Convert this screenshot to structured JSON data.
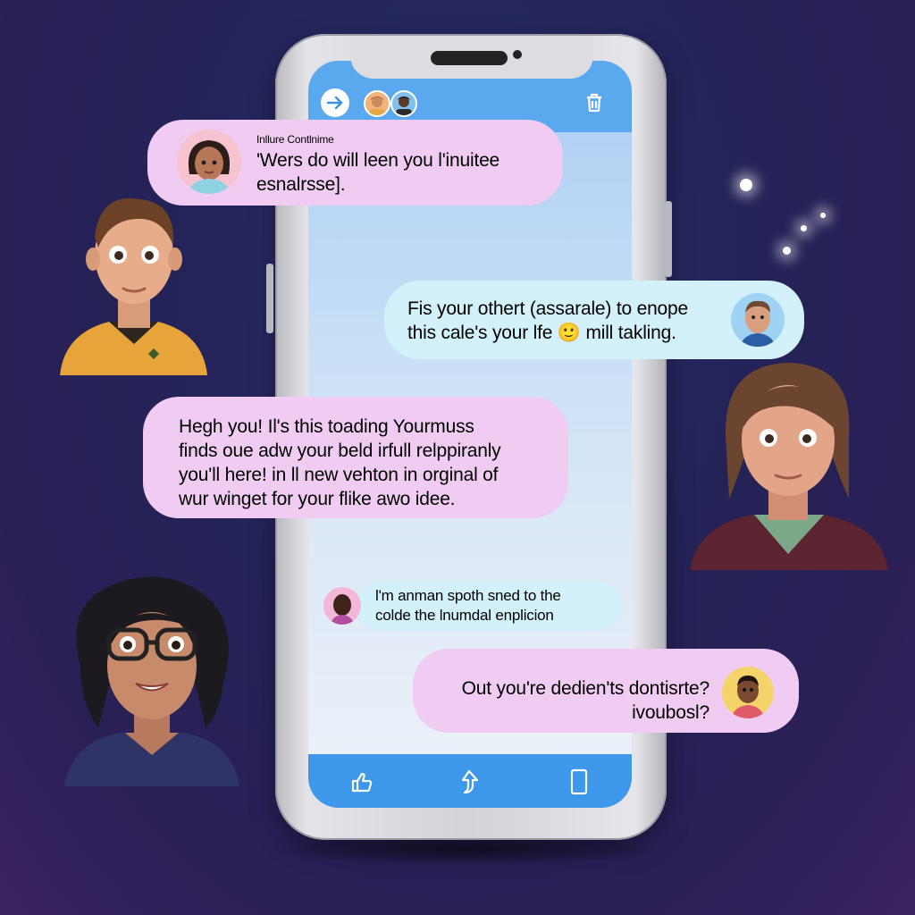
{
  "header": {
    "back_icon": "arrow-right-icon",
    "delete_icon": "trash-icon"
  },
  "footer": {
    "icons": [
      "like-icon",
      "share-icon",
      "phone-icon"
    ]
  },
  "messages": [
    {
      "sender": "Inllure Contlnime",
      "text_lines": [
        "'Wers do will leen you l'inuitee",
        "esnalrsse]."
      ],
      "style": "pink"
    },
    {
      "text_lines": [
        "Fis your othert (assarale) to enope",
        "this cale's your lfe 🙂 mill takling."
      ],
      "style": "blue"
    },
    {
      "text_lines": [
        "Hegh you! Il's this toading Yourmuss",
        "finds oue adw your beld irfull relppiranly",
        "you'll here! in ll new vehton in orginal of",
        "wur winget for your flike awo idee."
      ],
      "style": "pink"
    },
    {
      "text_lines": [
        "l'm anman spoth sned to the",
        "colde the lnumdal enplicion"
      ],
      "style": "blue"
    },
    {
      "text_lines": [
        "Out you're dedien'ts dontisrte?",
        "ivoubosl?"
      ],
      "style": "pink"
    }
  ],
  "colors": {
    "header": "#5aa9ee",
    "footer": "#3d97ea",
    "bubble_pink": "#f0ccf3",
    "bubble_blue": "#d3f1fb",
    "text": "#4a3d77"
  }
}
